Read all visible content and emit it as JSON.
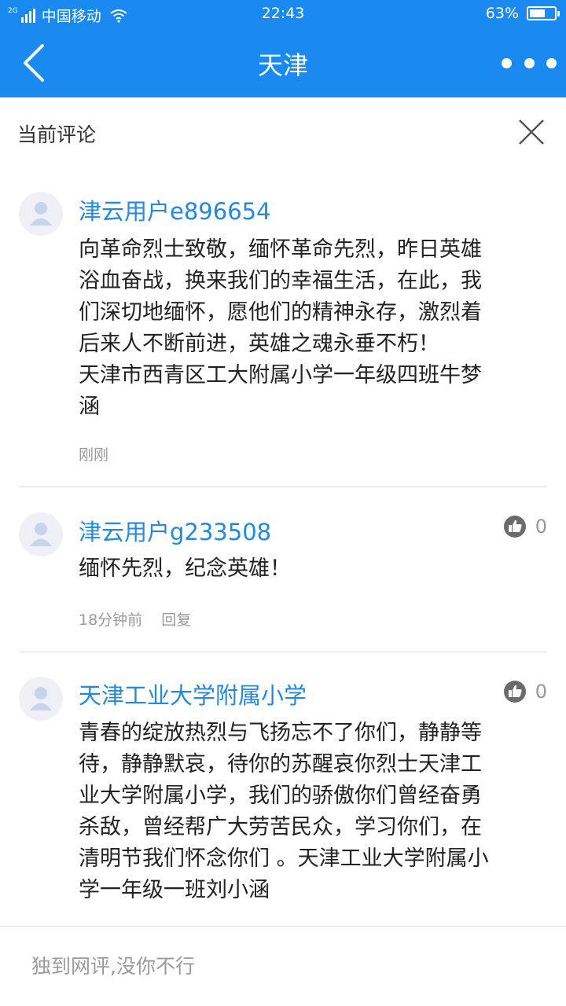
{
  "status_bar": {
    "network": "2G",
    "carrier": "中国移动",
    "time": "22:43",
    "battery_percent": "63%",
    "battery_level": 0.63
  },
  "nav": {
    "title": "天津"
  },
  "section": {
    "title": "当前评论"
  },
  "comments": [
    {
      "username": "津云用户e896654",
      "text": "向革命烈士致敬，缅怀革命先烈，昨日英雄浴血奋战，换来我们的幸福生活，在此，我们深切地缅怀，愿他们的精神永存，激烈着后来人不断前进，英雄之魂永垂不朽！\n天津市西青区工大附属小学一年级四班牛梦涵",
      "time": "刚刚"
    },
    {
      "username": "津云用户g233508",
      "text": "缅怀先烈，纪念英雄！",
      "time": "18分钟前",
      "reply_label": "回复",
      "likes": "0"
    },
    {
      "username": "天津工业大学附属小学",
      "text": "青春的绽放热烈与飞扬忘不了你们，静静等待，静静默哀，待你的苏醒哀你烈士天津工业大学附属小学，我们的骄傲你们曾经奋勇杀敌，曾经帮广大劳苦民众，学习你们，在清明节我们怀念你们 。天津工业大学附属小学一年级一班刘小涵",
      "likes": "0"
    }
  ],
  "input": {
    "placeholder": "独到网评,没你不行"
  },
  "colors": {
    "header_bg": "#1a89f0",
    "username": "#2288e0",
    "meta_text": "#9a9a9a"
  }
}
